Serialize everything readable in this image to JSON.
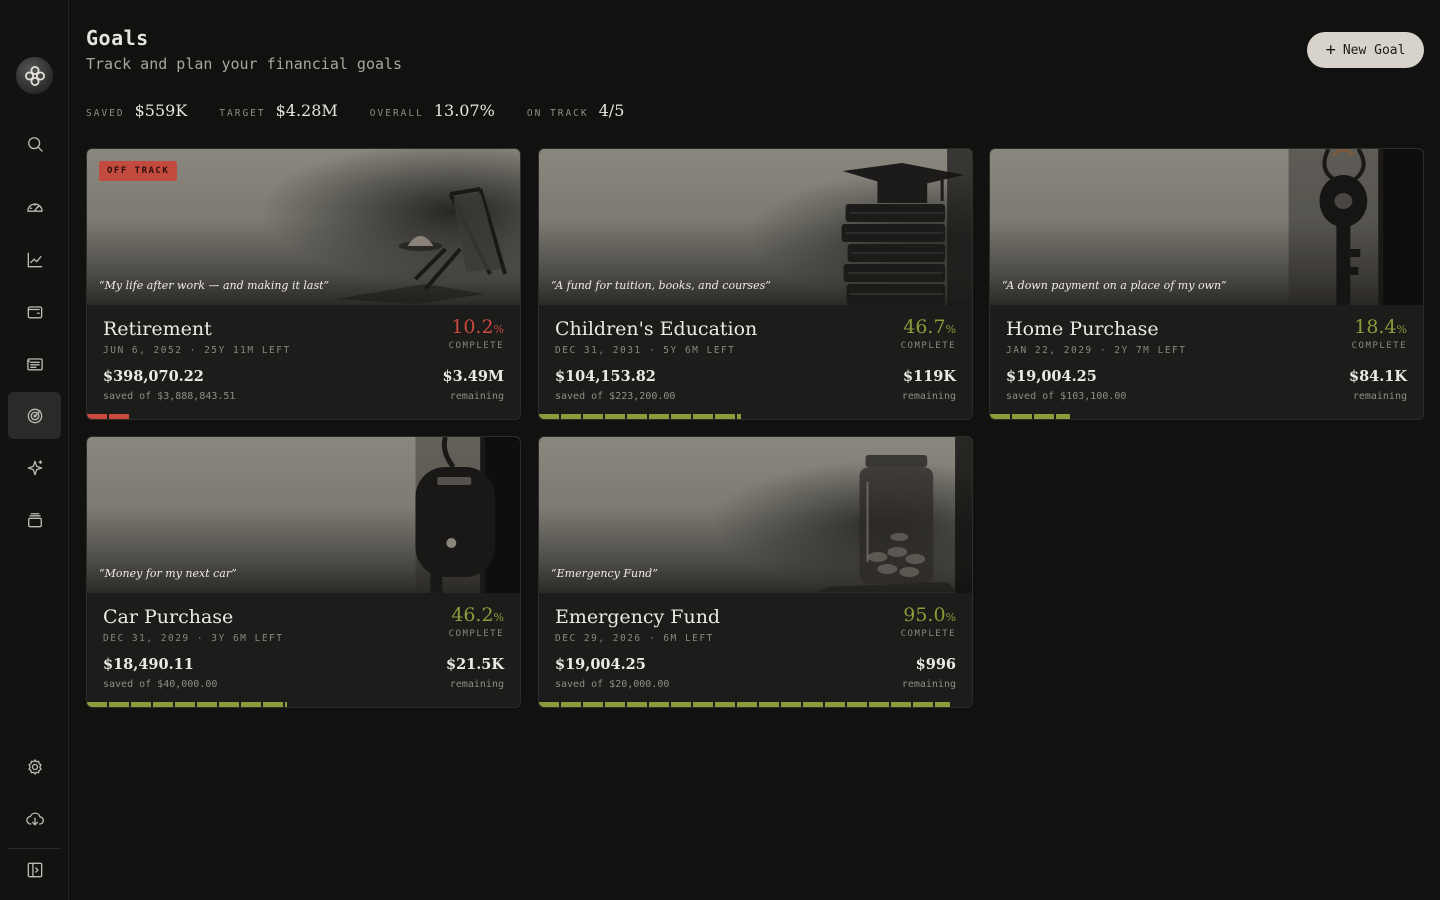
{
  "header": {
    "title": "Goals",
    "subtitle": "Track and plan your financial goals",
    "new_goal_label": "New Goal"
  },
  "stats": [
    {
      "label": "SAVED",
      "value": "$559K"
    },
    {
      "label": "TARGET",
      "value": "$4.28M"
    },
    {
      "label": "OVERALL",
      "value": "13.07%"
    },
    {
      "label": "ON TRACK",
      "value": "4/5"
    }
  ],
  "colors": {
    "accent_green": "#8f9a3a",
    "off_track_red": "#c9493e",
    "background": "#111110",
    "card": "#1c1c1b"
  },
  "sidebar": {
    "items": [
      {
        "name": "search",
        "icon": "search-icon"
      },
      {
        "name": "dashboard",
        "icon": "gauge-icon"
      },
      {
        "name": "investments",
        "icon": "chart-line-icon"
      },
      {
        "name": "accounts",
        "icon": "wallet-icon"
      },
      {
        "name": "transactions",
        "icon": "receipt-icon"
      },
      {
        "name": "goals",
        "icon": "target-icon",
        "active": true
      },
      {
        "name": "insights",
        "icon": "sparkle-icon"
      },
      {
        "name": "archive",
        "icon": "layers-icon"
      },
      {
        "name": "settings",
        "icon": "gear-icon"
      },
      {
        "name": "sync",
        "icon": "cloud-download-icon"
      },
      {
        "name": "collapse",
        "icon": "sidebar-toggle-icon"
      }
    ]
  },
  "goals": [
    {
      "name": "Retirement",
      "quote": "“My life after work — and making it last”",
      "badge": "OFF TRACK",
      "date": "JUN 6, 2052 · 25Y 11M LEFT",
      "percent": "10.2",
      "percent_unit": "%",
      "percent_label": "COMPLETE",
      "saved": "$398,070.22",
      "saved_of": "saved of $3,888,843.51",
      "remaining": "$3.49M",
      "remaining_label": "remaining",
      "progress": 0.102,
      "status_color": "#c9493e",
      "image": "deck-chair-icon"
    },
    {
      "name": "Children's Education",
      "quote": "“A fund for tuition, books, and courses”",
      "date": "DEC 31, 2031 · 5Y 6M LEFT",
      "percent": "46.7",
      "percent_unit": "%",
      "percent_label": "COMPLETE",
      "saved": "$104,153.82",
      "saved_of": "saved of $223,200.00",
      "remaining": "$119K",
      "remaining_label": "remaining",
      "progress": 0.467,
      "status_color": "#8f9a3a",
      "image": "graduation-books-icon"
    },
    {
      "name": "Home Purchase",
      "quote": "“A down payment on a place of my own”",
      "date": "JAN 22, 2029 · 2Y 7M LEFT",
      "percent": "18.4",
      "percent_unit": "%",
      "percent_label": "COMPLETE",
      "saved": "$19,004.25",
      "saved_of": "saved of $103,100.00",
      "remaining": "$84.1K",
      "remaining_label": "remaining",
      "progress": 0.184,
      "status_color": "#8f9a3a",
      "image": "house-key-icon"
    },
    {
      "name": "Car Purchase",
      "quote": "“Money for my next car”",
      "date": "DEC 31, 2029 · 3Y 6M LEFT",
      "percent": "46.2",
      "percent_unit": "%",
      "percent_label": "COMPLETE",
      "saved": "$18,490.11",
      "saved_of": "saved of $40,000.00",
      "remaining": "$21.5K",
      "remaining_label": "remaining",
      "progress": 0.462,
      "status_color": "#8f9a3a",
      "image": "car-key-icon"
    },
    {
      "name": "Emergency Fund",
      "quote": "“Emergency Fund”",
      "date": "DEC 29, 2026 · 6M LEFT",
      "percent": "95.0",
      "percent_unit": "%",
      "percent_label": "COMPLETE",
      "saved": "$19,004.25",
      "saved_of": "saved of $20,000.00",
      "remaining": "$996",
      "remaining_label": "remaining",
      "progress": 0.95,
      "status_color": "#8f9a3a",
      "image": "coin-jar-icon"
    }
  ]
}
